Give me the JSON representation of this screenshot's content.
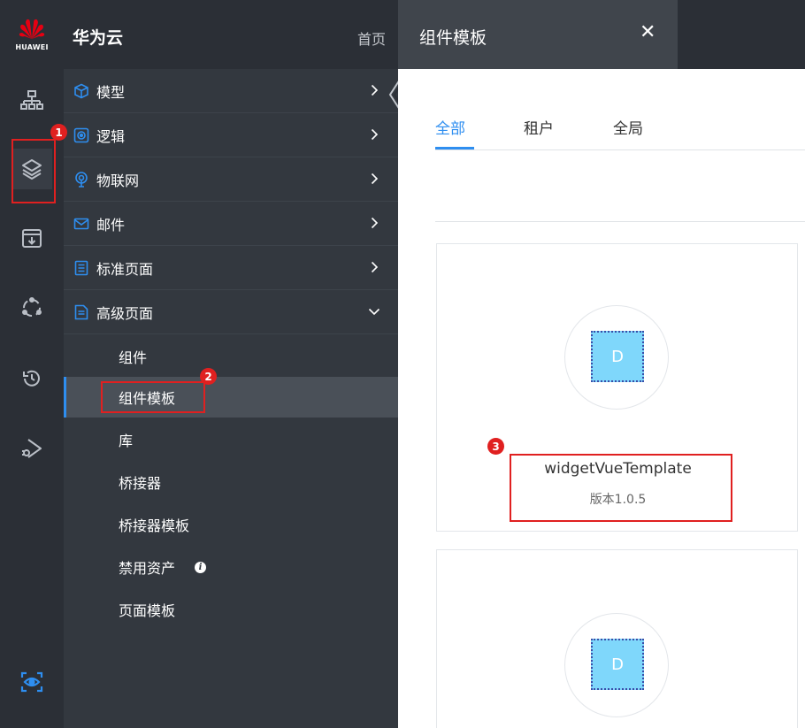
{
  "logo": {
    "text": "HUAWEI"
  },
  "menu_header": {
    "brand": "华为云",
    "home": "首页"
  },
  "menu": {
    "items": [
      {
        "label": "模型",
        "icon": "cube-icon"
      },
      {
        "label": "逻辑",
        "icon": "target-icon"
      },
      {
        "label": "物联网",
        "icon": "broadcast-icon"
      },
      {
        "label": "邮件",
        "icon": "mail-icon"
      },
      {
        "label": "标准页面",
        "icon": "list-page-icon"
      },
      {
        "label": "高级页面",
        "icon": "doc-page-icon"
      }
    ],
    "sub_items": [
      "组件",
      "组件模板",
      "库",
      "桥接器",
      "桥接器模板",
      "禁用资产",
      "页面模板"
    ],
    "info_glyph": "i"
  },
  "tab": {
    "title": "组件模板",
    "close": "✕"
  },
  "filter_tabs": [
    "全部",
    "租户",
    "全局"
  ],
  "cards": [
    {
      "letter": "D",
      "name": "widgetVueTemplate",
      "version": "版本1.0.5"
    },
    {
      "letter": "D"
    }
  ],
  "badges": [
    "1",
    "2",
    "3"
  ],
  "colors": {
    "accent": "#2e8ef0",
    "highlight": "#e02020",
    "sidebar": "#33383f",
    "rail": "#2b2f36"
  }
}
